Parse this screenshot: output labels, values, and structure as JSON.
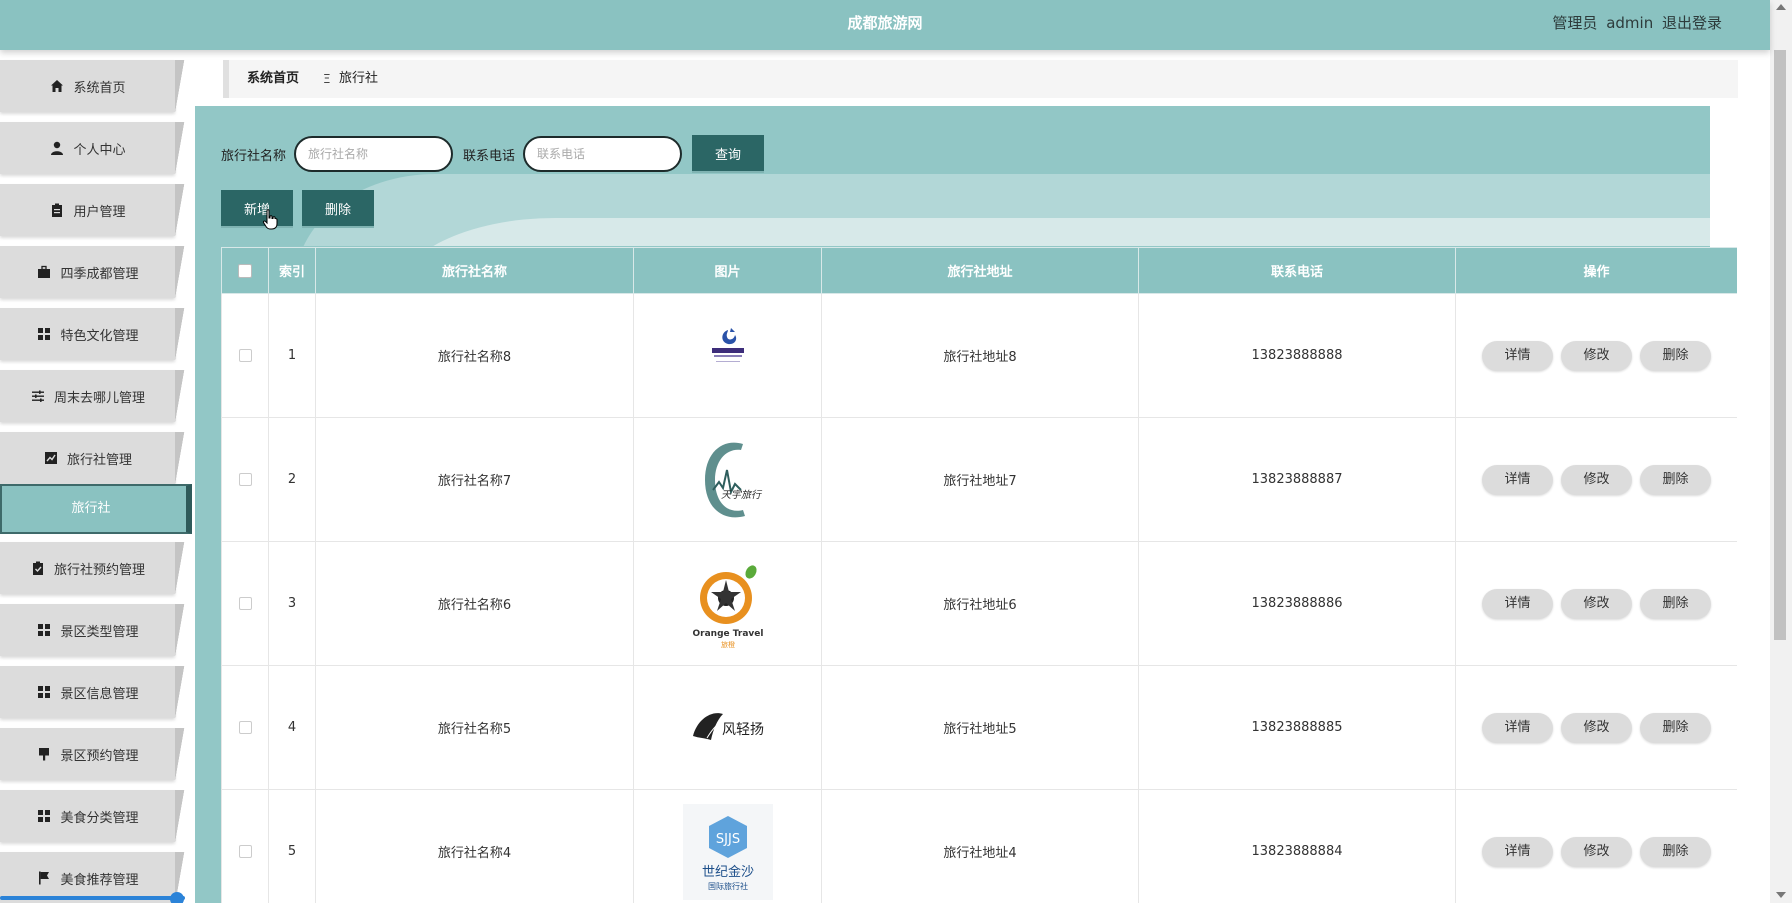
{
  "header": {
    "title": "成都旅游网",
    "role": "管理员",
    "username": "admin",
    "logout": "退出登录"
  },
  "sidebar": {
    "items": [
      {
        "label": "系统首页",
        "icon": "home-icon"
      },
      {
        "label": "个人中心",
        "icon": "user-icon"
      },
      {
        "label": "用户管理",
        "icon": "clipboard-icon"
      },
      {
        "label": "四季成都管理",
        "icon": "briefcase-icon"
      },
      {
        "label": "特色文化管理",
        "icon": "grid-icon"
      },
      {
        "label": "周末去哪儿管理",
        "icon": "sliders-icon"
      },
      {
        "label": "旅行社管理",
        "icon": "chart-icon"
      },
      {
        "label": "旅行社预约管理",
        "icon": "checklist-icon"
      },
      {
        "label": "景区类型管理",
        "icon": "grid-icon"
      },
      {
        "label": "景区信息管理",
        "icon": "grid-icon"
      },
      {
        "label": "景区预约管理",
        "icon": "brush-icon"
      },
      {
        "label": "美食分类管理",
        "icon": "grid-icon"
      },
      {
        "label": "美食推荐管理",
        "icon": "flag-icon"
      }
    ],
    "active_sub": "旅行社"
  },
  "breadcrumb": {
    "home": "系统首页",
    "separator": "Ξ",
    "current": "旅行社"
  },
  "search": {
    "name_label": "旅行社名称",
    "name_placeholder": "旅行社名称",
    "phone_label": "联系电话",
    "phone_placeholder": "联系电话",
    "query_button": "查询"
  },
  "actions": {
    "add": "新增",
    "delete": "删除"
  },
  "table": {
    "columns": [
      "索引",
      "旅行社名称",
      "图片",
      "旅行社地址",
      "联系电话",
      "操作"
    ],
    "row_actions": {
      "detail": "详情",
      "edit": "修改",
      "delete": "删除"
    },
    "rows": [
      {
        "index": "1",
        "name": "旅行社名称8",
        "address": "旅行社地址8",
        "phone": "13823888888",
        "logo": "logo-blue-travel"
      },
      {
        "index": "2",
        "name": "旅行社名称7",
        "address": "旅行社地址7",
        "phone": "13823888887",
        "logo": "logo-tianyu-travel"
      },
      {
        "index": "3",
        "name": "旅行社名称6",
        "address": "旅行社地址6",
        "phone": "13823888886",
        "logo": "logo-orange-travel"
      },
      {
        "index": "4",
        "name": "旅行社名称5",
        "address": "旅行社地址5",
        "phone": "13823888885",
        "logo": "logo-fengqingyang"
      },
      {
        "index": "5",
        "name": "旅行社名称4",
        "address": "旅行社地址4",
        "phone": "13823888884",
        "logo": "logo-sjjs"
      }
    ]
  },
  "logo_text": {
    "orange_en": "Orange Travel",
    "orange_cn": "旅橙",
    "tianyu": "天宇旅行",
    "feng": "风轻扬",
    "sjjs_badge": "SJJS",
    "sjjs_cn1": "世纪金沙",
    "sjjs_cn2": "国际旅行社"
  },
  "colors": {
    "header": "#8ac2c1",
    "main": "#92c7c6",
    "button": "#2b6665",
    "menu": "#dcdcdc"
  }
}
